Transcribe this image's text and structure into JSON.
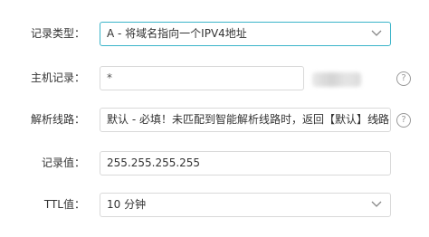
{
  "form": {
    "record_type": {
      "label": "记录类型：",
      "value": "A - 将域名指向一个IPV4地址"
    },
    "host": {
      "label": "主机记录：",
      "value": "*",
      "help": "?"
    },
    "line": {
      "label": "解析线路：",
      "value": "默认 - 必填！未匹配到智能解析线路时，返回【默认】线路…",
      "help": "?"
    },
    "record_value": {
      "label": "记录值：",
      "value": "255.255.255.255"
    },
    "ttl": {
      "label": "TTL值：",
      "value": "10 分钟"
    }
  },
  "colors": {
    "focus_border": "#3bb4c9",
    "border": "#d9d9d9"
  },
  "icons": [
    "chevron-down-icon",
    "help-circle-icon"
  ]
}
